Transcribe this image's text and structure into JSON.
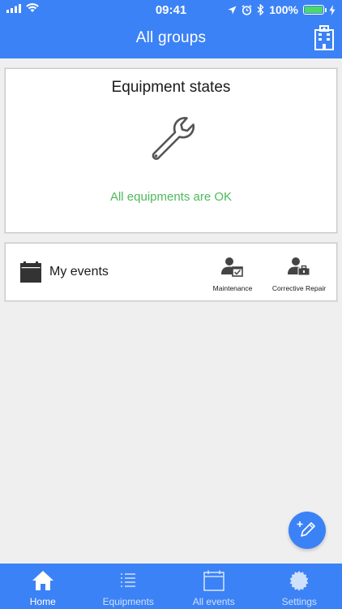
{
  "status_bar": {
    "time": "09:41",
    "battery_percent": "100%",
    "battery_level": 1.0
  },
  "header": {
    "title": "All groups",
    "building_icon": "building-icon"
  },
  "equipment_card": {
    "title": "Equipment states",
    "icon": "wrench-icon",
    "status_text": "All equipments are OK",
    "status_color": "#4cba5c"
  },
  "events_card": {
    "label": "My events",
    "icon": "calendar-icon",
    "types": [
      {
        "label": "Maintenance",
        "icon": "user-check-icon"
      },
      {
        "label": "Corrective Repair",
        "icon": "user-toolbox-icon"
      }
    ]
  },
  "fab": {
    "icon": "edit-plus-icon"
  },
  "bottom_nav": {
    "items": [
      {
        "label": "Home",
        "icon": "home-icon",
        "active": true
      },
      {
        "label": "Equipments",
        "icon": "list-icon",
        "active": false
      },
      {
        "label": "All events",
        "icon": "calendar-icon",
        "active": false
      },
      {
        "label": "Settings",
        "icon": "gear-icon",
        "active": false
      }
    ]
  },
  "colors": {
    "primary": "#3b82f6",
    "background": "#efefef",
    "ok_green": "#4cba5c"
  }
}
